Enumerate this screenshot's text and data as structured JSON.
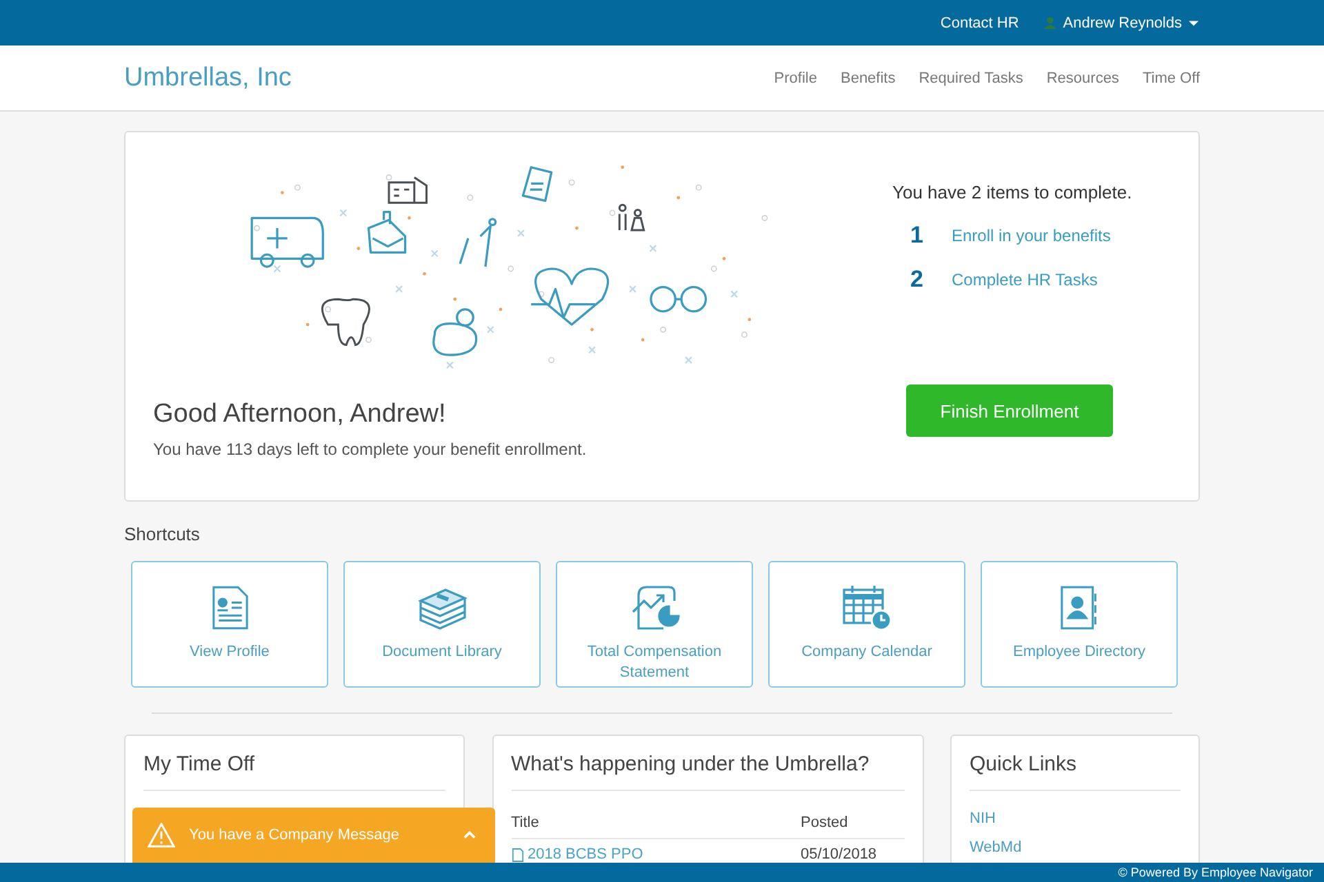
{
  "top_bar": {
    "links": [
      "Contact HR"
    ],
    "user": {
      "name": "Andrew Reynolds"
    }
  },
  "header": {
    "brand": "Umbrellas, Inc",
    "nav": [
      "Profile",
      "Benefits",
      "Required Tasks",
      "Resources",
      "Time Off"
    ]
  },
  "hero": {
    "todo_title": "You have 2 items to complete.",
    "items": [
      {
        "number": "1",
        "label": "Enroll in your benefits"
      },
      {
        "number": "2",
        "label": "Complete HR Tasks"
      }
    ],
    "greeting": "Good Afternoon, Andrew!",
    "subtitle": "You have 113 days left to complete your benefit enrollment.",
    "button": "Finish Enrollment"
  },
  "shortcuts": {
    "title": "Shortcuts",
    "items": [
      {
        "kind": "profile",
        "label": "View Profile"
      },
      {
        "kind": "library",
        "label": "Document Library"
      },
      {
        "kind": "compensation",
        "label": "Total Compensation Statement"
      },
      {
        "kind": "calendar",
        "label": "Company Calendar"
      },
      {
        "kind": "directory",
        "label": "Employee Directory"
      }
    ]
  },
  "time_off": {
    "title": "My Time Off"
  },
  "news": {
    "title": "What's happening under the Umbrella?",
    "columns": [
      "Title",
      "Posted"
    ],
    "rows": [
      {
        "title": "2018 BCBS PPO",
        "posted": "05/10/2018"
      }
    ]
  },
  "quick_links": {
    "title": "Quick Links",
    "links": [
      "NIH",
      "WebMd"
    ]
  },
  "message_bar": {
    "text": "You have a Company Message"
  },
  "footer": {
    "text": "© Powered By Employee Navigator"
  }
}
